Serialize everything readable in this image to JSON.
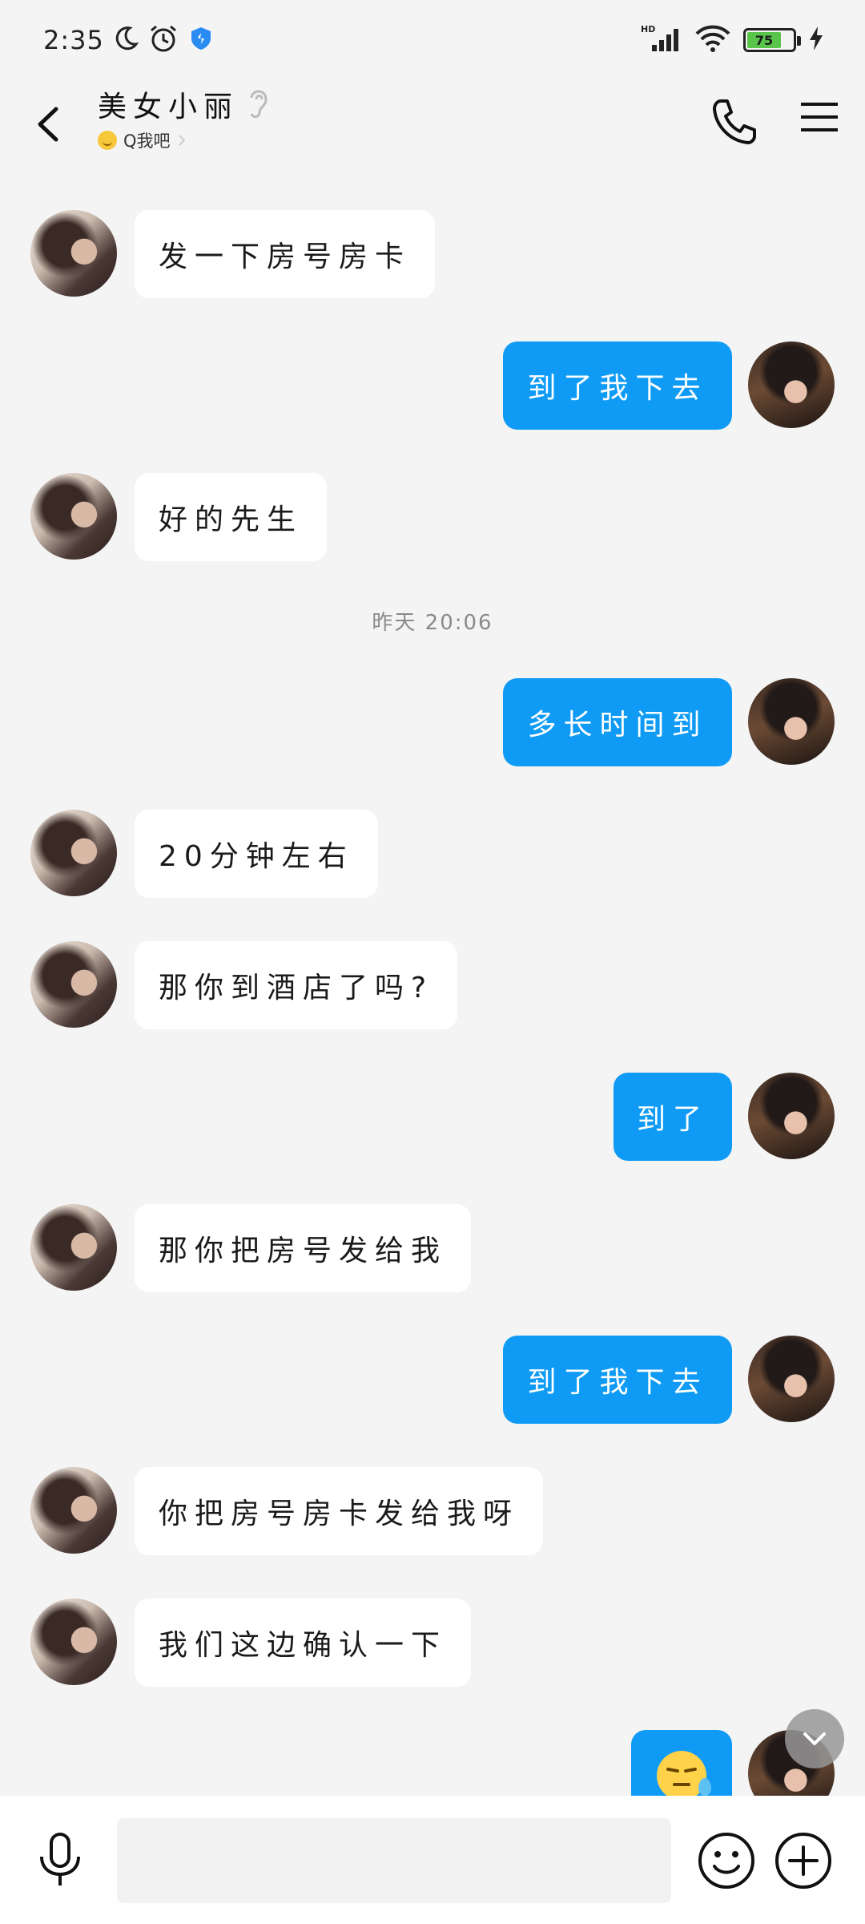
{
  "status_bar": {
    "time": "2:35",
    "network": "HD",
    "battery_level": "75",
    "battery_percent": 75,
    "icons": [
      "moon-icon",
      "alarm-icon",
      "shield-icon",
      "signal-icon",
      "wifi-icon",
      "battery-icon",
      "charging-icon"
    ]
  },
  "header": {
    "contact_name": "美女小丽",
    "status_text": "Q我吧",
    "icons": [
      "back-icon",
      "ear-icon",
      "phone-icon",
      "menu-icon"
    ]
  },
  "timestamp": "昨天 20:06",
  "messages": [
    {
      "side": "in",
      "text": "发一下房号房卡"
    },
    {
      "side": "out",
      "text": "到了我下去"
    },
    {
      "side": "in",
      "text": "好的先生"
    },
    {
      "side": "out",
      "text": "多长时间到"
    },
    {
      "side": "in",
      "text": "20分钟左右"
    },
    {
      "side": "in",
      "text": "那你到酒店了吗?"
    },
    {
      "side": "out",
      "text": "到了"
    },
    {
      "side": "in",
      "text": "那你把房号发给我"
    },
    {
      "side": "out",
      "text": "到了我下去"
    },
    {
      "side": "in",
      "text": "你把房号房卡发给我呀"
    },
    {
      "side": "in",
      "text": "我们这边确认一下"
    },
    {
      "side": "out",
      "emoji": "sweat-face-emoji"
    }
  ],
  "input": {
    "placeholder": "",
    "value": ""
  },
  "colors": {
    "outgoing_bubble": "#0f9bf5",
    "incoming_bubble": "#ffffff",
    "background": "#f4f4f4"
  }
}
